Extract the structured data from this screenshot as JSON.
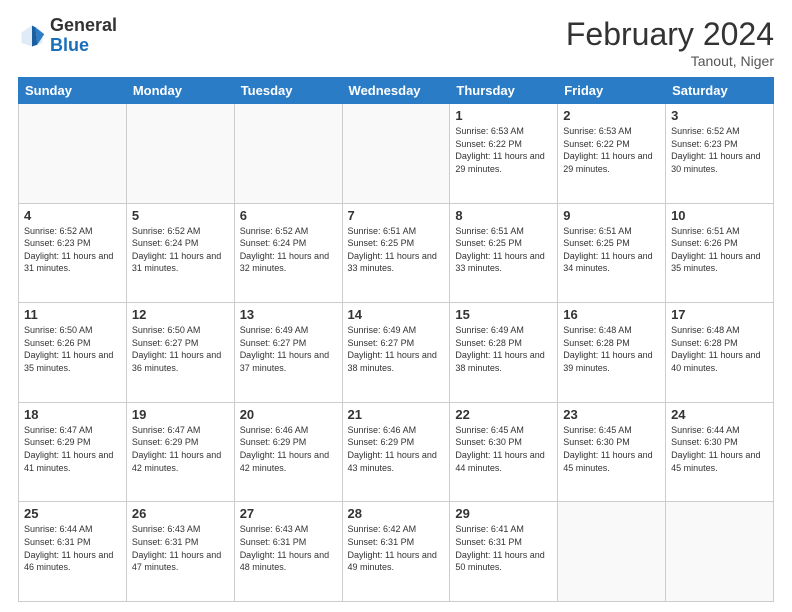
{
  "header": {
    "logo_general": "General",
    "logo_blue": "Blue",
    "month_title": "February 2024",
    "location": "Tanout, Niger"
  },
  "days_of_week": [
    "Sunday",
    "Monday",
    "Tuesday",
    "Wednesday",
    "Thursday",
    "Friday",
    "Saturday"
  ],
  "weeks": [
    [
      {
        "day": "",
        "info": ""
      },
      {
        "day": "",
        "info": ""
      },
      {
        "day": "",
        "info": ""
      },
      {
        "day": "",
        "info": ""
      },
      {
        "day": "1",
        "info": "Sunrise: 6:53 AM\nSunset: 6:22 PM\nDaylight: 11 hours and 29 minutes."
      },
      {
        "day": "2",
        "info": "Sunrise: 6:53 AM\nSunset: 6:22 PM\nDaylight: 11 hours and 29 minutes."
      },
      {
        "day": "3",
        "info": "Sunrise: 6:52 AM\nSunset: 6:23 PM\nDaylight: 11 hours and 30 minutes."
      }
    ],
    [
      {
        "day": "4",
        "info": "Sunrise: 6:52 AM\nSunset: 6:23 PM\nDaylight: 11 hours and 31 minutes."
      },
      {
        "day": "5",
        "info": "Sunrise: 6:52 AM\nSunset: 6:24 PM\nDaylight: 11 hours and 31 minutes."
      },
      {
        "day": "6",
        "info": "Sunrise: 6:52 AM\nSunset: 6:24 PM\nDaylight: 11 hours and 32 minutes."
      },
      {
        "day": "7",
        "info": "Sunrise: 6:51 AM\nSunset: 6:25 PM\nDaylight: 11 hours and 33 minutes."
      },
      {
        "day": "8",
        "info": "Sunrise: 6:51 AM\nSunset: 6:25 PM\nDaylight: 11 hours and 33 minutes."
      },
      {
        "day": "9",
        "info": "Sunrise: 6:51 AM\nSunset: 6:25 PM\nDaylight: 11 hours and 34 minutes."
      },
      {
        "day": "10",
        "info": "Sunrise: 6:51 AM\nSunset: 6:26 PM\nDaylight: 11 hours and 35 minutes."
      }
    ],
    [
      {
        "day": "11",
        "info": "Sunrise: 6:50 AM\nSunset: 6:26 PM\nDaylight: 11 hours and 35 minutes."
      },
      {
        "day": "12",
        "info": "Sunrise: 6:50 AM\nSunset: 6:27 PM\nDaylight: 11 hours and 36 minutes."
      },
      {
        "day": "13",
        "info": "Sunrise: 6:49 AM\nSunset: 6:27 PM\nDaylight: 11 hours and 37 minutes."
      },
      {
        "day": "14",
        "info": "Sunrise: 6:49 AM\nSunset: 6:27 PM\nDaylight: 11 hours and 38 minutes."
      },
      {
        "day": "15",
        "info": "Sunrise: 6:49 AM\nSunset: 6:28 PM\nDaylight: 11 hours and 38 minutes."
      },
      {
        "day": "16",
        "info": "Sunrise: 6:48 AM\nSunset: 6:28 PM\nDaylight: 11 hours and 39 minutes."
      },
      {
        "day": "17",
        "info": "Sunrise: 6:48 AM\nSunset: 6:28 PM\nDaylight: 11 hours and 40 minutes."
      }
    ],
    [
      {
        "day": "18",
        "info": "Sunrise: 6:47 AM\nSunset: 6:29 PM\nDaylight: 11 hours and 41 minutes."
      },
      {
        "day": "19",
        "info": "Sunrise: 6:47 AM\nSunset: 6:29 PM\nDaylight: 11 hours and 42 minutes."
      },
      {
        "day": "20",
        "info": "Sunrise: 6:46 AM\nSunset: 6:29 PM\nDaylight: 11 hours and 42 minutes."
      },
      {
        "day": "21",
        "info": "Sunrise: 6:46 AM\nSunset: 6:29 PM\nDaylight: 11 hours and 43 minutes."
      },
      {
        "day": "22",
        "info": "Sunrise: 6:45 AM\nSunset: 6:30 PM\nDaylight: 11 hours and 44 minutes."
      },
      {
        "day": "23",
        "info": "Sunrise: 6:45 AM\nSunset: 6:30 PM\nDaylight: 11 hours and 45 minutes."
      },
      {
        "day": "24",
        "info": "Sunrise: 6:44 AM\nSunset: 6:30 PM\nDaylight: 11 hours and 45 minutes."
      }
    ],
    [
      {
        "day": "25",
        "info": "Sunrise: 6:44 AM\nSunset: 6:31 PM\nDaylight: 11 hours and 46 minutes."
      },
      {
        "day": "26",
        "info": "Sunrise: 6:43 AM\nSunset: 6:31 PM\nDaylight: 11 hours and 47 minutes."
      },
      {
        "day": "27",
        "info": "Sunrise: 6:43 AM\nSunset: 6:31 PM\nDaylight: 11 hours and 48 minutes."
      },
      {
        "day": "28",
        "info": "Sunrise: 6:42 AM\nSunset: 6:31 PM\nDaylight: 11 hours and 49 minutes."
      },
      {
        "day": "29",
        "info": "Sunrise: 6:41 AM\nSunset: 6:31 PM\nDaylight: 11 hours and 50 minutes."
      },
      {
        "day": "",
        "info": ""
      },
      {
        "day": "",
        "info": ""
      }
    ]
  ]
}
